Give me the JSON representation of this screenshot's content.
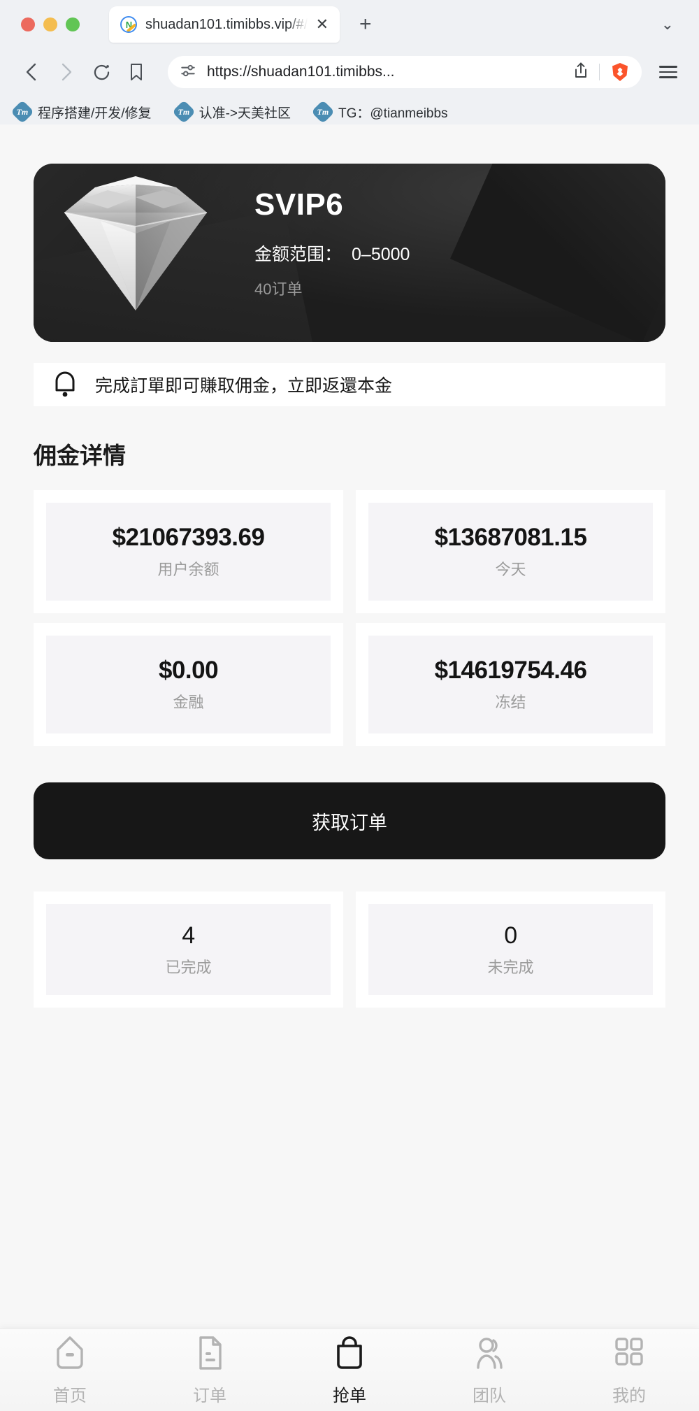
{
  "browser": {
    "tab": {
      "title": "shuadan101.timibbs.vip/#/pag",
      "favicon": "app-logo-icon",
      "close_label": "✕",
      "newtab_label": "+",
      "tab_list_chevron": "⌄"
    },
    "toolbar": {
      "back": "‹",
      "forward": "›",
      "reload": "reload-icon",
      "bookmark": "bookmark-icon",
      "permissions": "site-settings-icon",
      "url": "https://shuadan101.timibbs...",
      "share": "share-icon",
      "shield": "brave-shield-icon",
      "menu": "hamburger-menu-icon"
    },
    "bookmarks": [
      {
        "icon": "Tm",
        "label": "程序搭建/开发/修复"
      },
      {
        "icon": "Tm",
        "label": "认准->天美社区"
      },
      {
        "icon": "Tm",
        "label": "TG：@tianmeibbs"
      }
    ]
  },
  "page": {
    "vip_card": {
      "gem_icon": "diamond-icon",
      "level": "SVIP6",
      "range_label": "金额范围：",
      "range_value": "0–5000",
      "orders": "40订单"
    },
    "notice": {
      "icon": "bell-icon",
      "text": "完成訂單即可賺取佣金，立即返還本金"
    },
    "section_title": "佣金详情",
    "stats": [
      {
        "value": "$21067393.69",
        "label": "用户余额"
      },
      {
        "value": "$13687081.15",
        "label": "今天"
      },
      {
        "value": "$0.00",
        "label": "金融"
      },
      {
        "value": "$14619754.46",
        "label": "冻结"
      }
    ],
    "cta_label": "获取订单",
    "order_stats": [
      {
        "value": "4",
        "label": "已完成"
      },
      {
        "value": "0",
        "label": "未完成"
      }
    ],
    "bottom_nav": [
      {
        "icon": "home-icon",
        "label": "首页",
        "active": false
      },
      {
        "icon": "document-icon",
        "label": "订单",
        "active": false
      },
      {
        "icon": "bag-icon",
        "label": "抢单",
        "active": true
      },
      {
        "icon": "people-icon",
        "label": "团队",
        "active": false
      },
      {
        "icon": "grid-icon",
        "label": "我的",
        "active": false
      }
    ]
  },
  "colors": {
    "dark": "#171717",
    "page_bg": "#f7f7f7",
    "card_bg": "#f5f4f7",
    "muted": "#9b9b9b",
    "chrome_bg": "#eff1f4",
    "brave_orange": "#fb542b"
  }
}
